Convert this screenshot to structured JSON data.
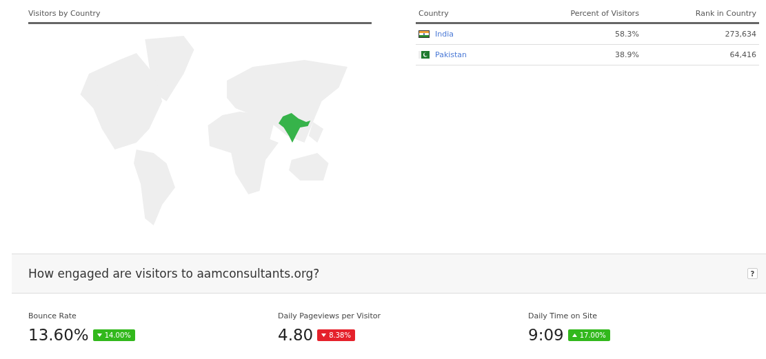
{
  "map_panel": {
    "title": "Visitors by Country"
  },
  "country_table": {
    "columns": [
      "Country",
      "Percent of Visitors",
      "Rank in Country"
    ],
    "rows": [
      {
        "country": "India",
        "percent": "58.3%",
        "rank": "273,634"
      },
      {
        "country": "Pakistan",
        "percent": "38.9%",
        "rank": "64,416"
      }
    ]
  },
  "engagement": {
    "title": "How engaged are visitors to aamconsultants.org?",
    "help": "?",
    "metrics": [
      {
        "label": "Bounce Rate",
        "value": "13.60%",
        "change": "14.00%",
        "up": false,
        "bad": false
      },
      {
        "label": "Daily Pageviews per Visitor",
        "value": "4.80",
        "change": "8.38%",
        "up": false,
        "bad": true
      },
      {
        "label": "Daily Time on Site",
        "value": "9:09",
        "change": "17.00%",
        "up": true,
        "bad": false
      }
    ]
  }
}
